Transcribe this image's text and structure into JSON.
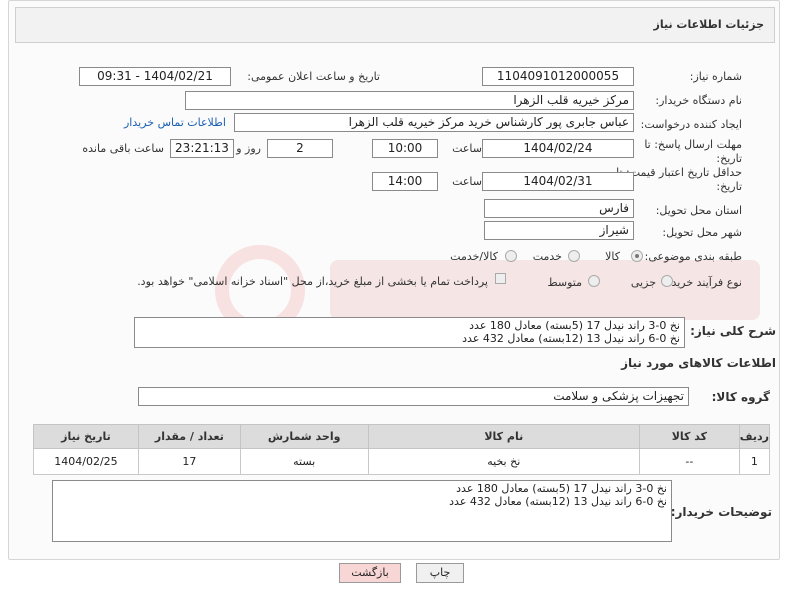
{
  "header": {
    "title": "جزئیات اطلاعات نیاز"
  },
  "fields": {
    "need_number_label": "شماره نیاز:",
    "need_number": "1104091012000055",
    "announce_label": "تاریخ و ساعت اعلان عمومی:",
    "announce_value": "1404/02/21 - 09:31",
    "buyer_org_label": "نام دستگاه خریدار:",
    "buyer_org": "مرکز خیریه قلب الزهرا",
    "creator_label": "ایجاد کننده درخواست:",
    "creator": "عباس جابری پور کارشناس خرید مرکز خیریه قلب الزهرا",
    "contact_link": "اطلاعات تماس خریدار",
    "deadline_label": "مهلت ارسال پاسخ: تا تاریخ:",
    "deadline_date": "1404/02/24",
    "time_label": "ساعت",
    "deadline_time": "10:00",
    "days_value": "2",
    "days_label": "روز و",
    "remaining_time": "23:21:13",
    "remaining_label": "ساعت باقی مانده",
    "validity_label": "حداقل تاریخ اعتبار قیمت: تا تاریخ:",
    "validity_date": "1404/02/31",
    "validity_time_label": "ساعت",
    "validity_time": "14:00",
    "province_label": "استان محل تحویل:",
    "province": "فارس",
    "city_label": "شهر محل تحویل:",
    "city": "شیراز",
    "category_label": "طبقه بندی موضوعی:",
    "category_options": [
      "کالا",
      "خدمت",
      "کالا/خدمت"
    ],
    "process_label": "نوع فرآیند خرید :",
    "process_options": [
      "جزیی",
      "متوسط"
    ],
    "process_note": "پرداخت تمام یا بخشی از مبلغ خرید،از محل \"اسناد خزانه اسلامی\" خواهد بود."
  },
  "description": {
    "label": "شرح کلی نیاز:",
    "text": "نخ 0-3  راند نیدل 17   (5بسته)  معادل 180 عدد\nنخ 0-6  راند نیدل 13   (12بسته) معادل 432 عدد"
  },
  "goods_info": {
    "title": "اطلاعات کالاهای مورد نیاز",
    "group_label": "گروه کالا:",
    "group_value": "تجهیزات پزشکی و سلامت"
  },
  "table": {
    "headers": [
      "ردیف",
      "کد کالا",
      "نام کالا",
      "واحد شمارش",
      "تعداد / مقدار",
      "تاریخ نیاز"
    ],
    "rows": [
      [
        "1",
        "--",
        "نخ بخیه",
        "بسته",
        "17",
        "1404/02/25"
      ]
    ]
  },
  "buyer_notes": {
    "label": "توضیحات خریدار:",
    "text": "نخ 0-3  راند نیدل 17   (5بسته)  معادل 180 عدد\nنخ 0-6  راند نیدل 13   (12بسته) معادل 432 عدد"
  },
  "buttons": {
    "print": "چاپ",
    "back": "بازگشت"
  },
  "colors": {
    "link": "#1a5fb4",
    "back_button_bg": "#f9d6d6",
    "table_header_bg": "#dcdcdc"
  }
}
